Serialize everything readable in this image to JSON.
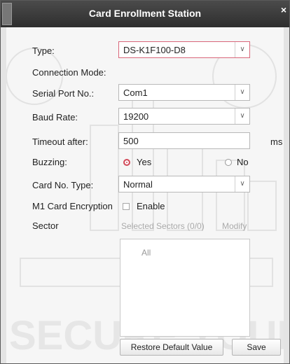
{
  "window": {
    "title": "Card Enrollment Station",
    "close_glyph": "×"
  },
  "form": {
    "type": {
      "label": "Type:",
      "value": "DS-K1F100-D8"
    },
    "connection_mode": {
      "label": "Connection Mode:"
    },
    "serial_port": {
      "label": "Serial Port No.:",
      "value": "Com1"
    },
    "baud_rate": {
      "label": "Baud Rate:",
      "value": "19200"
    },
    "timeout": {
      "label": "Timeout after:",
      "value": "500",
      "unit": "ms"
    },
    "buzzing": {
      "label": "Buzzing:",
      "options": [
        "Yes",
        "No"
      ],
      "selected": "Yes"
    },
    "card_no_type": {
      "label": "Card No. Type:",
      "value": "Normal"
    },
    "m1_encryption": {
      "label": "M1 Card Encryption",
      "checkbox_label": "Enable",
      "checked": false
    },
    "sector": {
      "label": "Sector",
      "selected_text": "Selected Sectors (0/0)",
      "modify_label": "Modify",
      "items": [
        "All"
      ]
    }
  },
  "footer": {
    "restore_label": "Restore Default Value",
    "save_label": "Save"
  },
  "watermark": {
    "text": "SECURE YOUR"
  },
  "colors": {
    "accent": "#d24d5c",
    "titlebar": "#3a3a3a",
    "panel": "#f6f6f6"
  }
}
